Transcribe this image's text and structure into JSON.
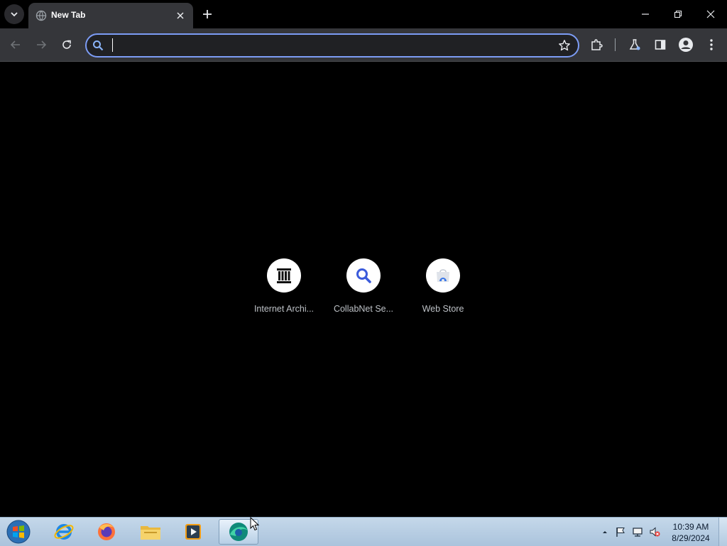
{
  "browser": {
    "tab": {
      "title": "New Tab"
    },
    "omnibox": {
      "value": "",
      "placeholder": ""
    }
  },
  "shortcuts": [
    {
      "label": "Internet Archi...",
      "icon": "archive-building-icon"
    },
    {
      "label": "CollabNet Se...",
      "icon": "magnifier-icon"
    },
    {
      "label": "Web Store",
      "icon": "web-store-icon"
    }
  ],
  "taskbar": {
    "apps": [
      {
        "name": "internet-explorer",
        "icon": "ie-icon"
      },
      {
        "name": "firefox",
        "icon": "firefox-icon"
      },
      {
        "name": "file-explorer",
        "icon": "folder-icon"
      },
      {
        "name": "media-player",
        "icon": "media-player-icon"
      },
      {
        "name": "browser",
        "icon": "browser-icon",
        "active": true
      }
    ],
    "clock": {
      "time": "10:39 AM",
      "date": "8/29/2024"
    }
  },
  "colors": {
    "page_bg": "#000000",
    "toolbar_bg": "#35363a",
    "omnibox_border": "#7c9cf5",
    "accent_blue": "#3b5bdb"
  }
}
